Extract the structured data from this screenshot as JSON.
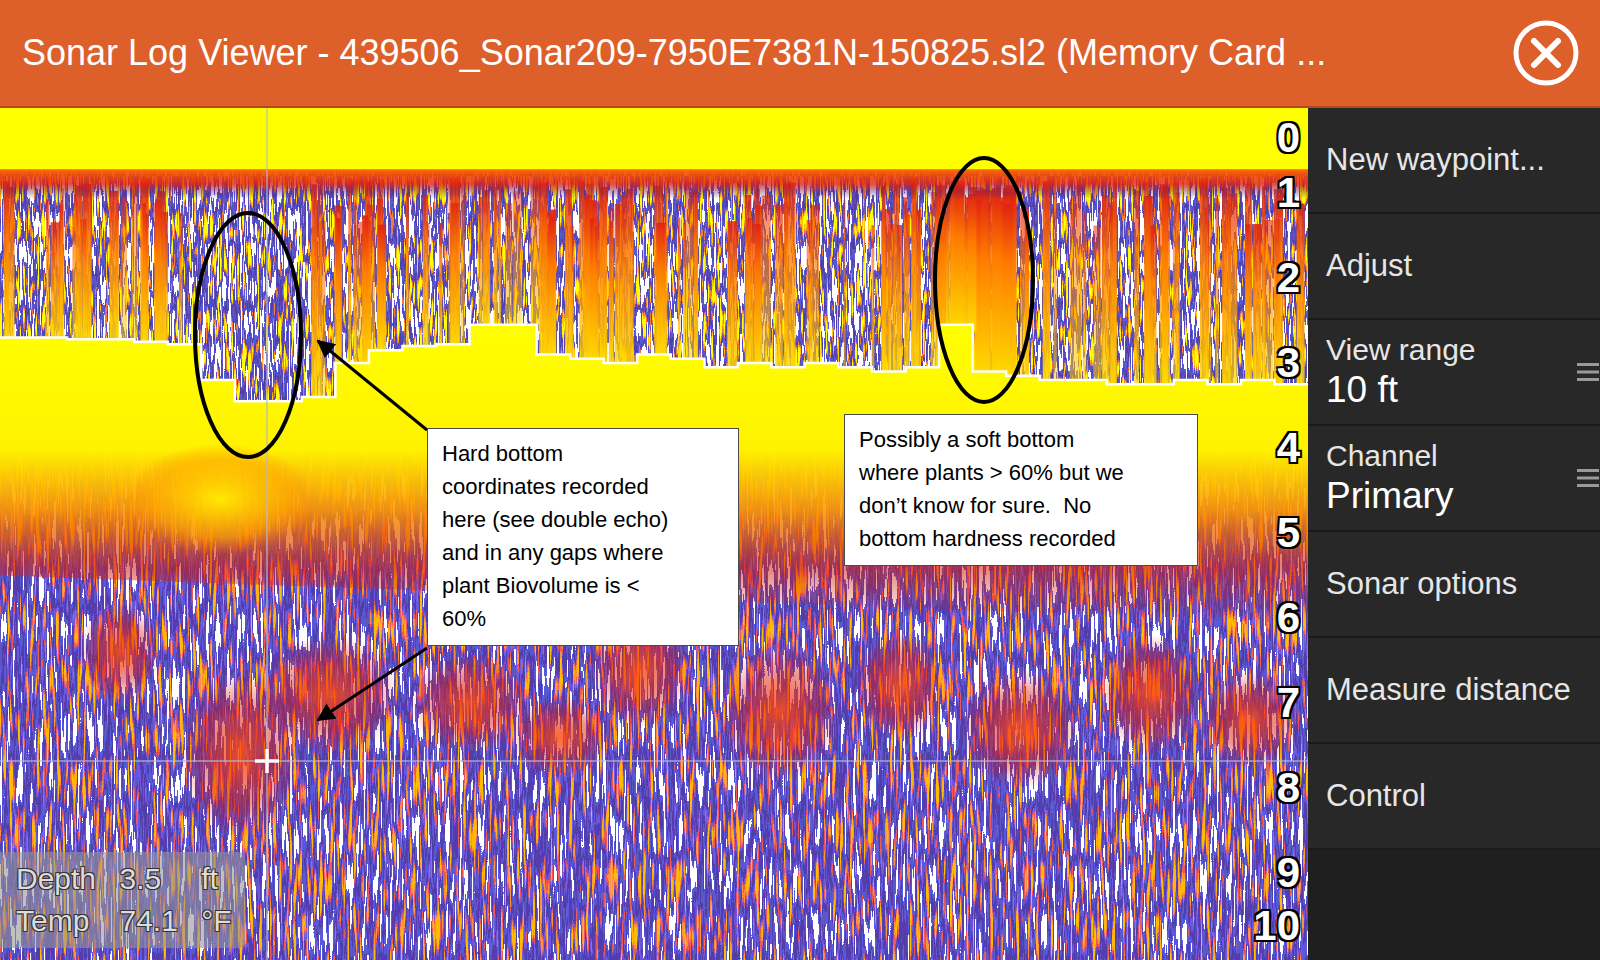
{
  "window": {
    "title": "Sonar Log Viewer - 439506_Sonar209-7950E7381N-150825.sl2 (Memory Card ..."
  },
  "sonar": {
    "depth_ticks": [
      "0",
      "1",
      "2",
      "3",
      "4",
      "5",
      "6",
      "7",
      "8",
      "9",
      "10"
    ],
    "bottom_line_ft": [
      2.7,
      2.7,
      2.72,
      2.72,
      2.75,
      2.78,
      3.2,
      3.45,
      3.45,
      3.4,
      3.0,
      2.85,
      2.8,
      2.78,
      2.55,
      2.55,
      2.9,
      2.95,
      3.0,
      2.9,
      2.95,
      3.05,
      3.0,
      3.05,
      3.0,
      3.05,
      3.1,
      3.05,
      2.55,
      3.1,
      3.15,
      3.2,
      3.2,
      3.25,
      3.25,
      3.2,
      3.25,
      3.2,
      3.25,
      3.25
    ],
    "readouts": [
      {
        "label": "Depth",
        "value": "3.5",
        "unit": "ft"
      },
      {
        "label": "Temp",
        "value": "74.1",
        "unit": "°F"
      }
    ],
    "annotations": [
      {
        "lines": [
          "Hard bottom",
          "coordinates recorded",
          "here (see double echo)",
          "and in any gaps where",
          "plant Biovolume is <",
          "60%"
        ]
      },
      {
        "lines": [
          "Possibly a soft bottom",
          "where plants > 60% but we",
          "don’t know for sure.  No",
          "bottom hardness recorded"
        ]
      }
    ]
  },
  "sidebar": {
    "items": [
      {
        "label": "New waypoint...",
        "kind": "button"
      },
      {
        "label": "Adjust",
        "kind": "button"
      },
      {
        "label": "View range",
        "value": "10 ft",
        "kind": "setting"
      },
      {
        "label": "Channel",
        "value": "Primary",
        "kind": "setting"
      },
      {
        "label": "Sonar options",
        "kind": "button"
      },
      {
        "label": "Measure distance",
        "kind": "button"
      },
      {
        "label": "Control",
        "kind": "button"
      }
    ]
  }
}
